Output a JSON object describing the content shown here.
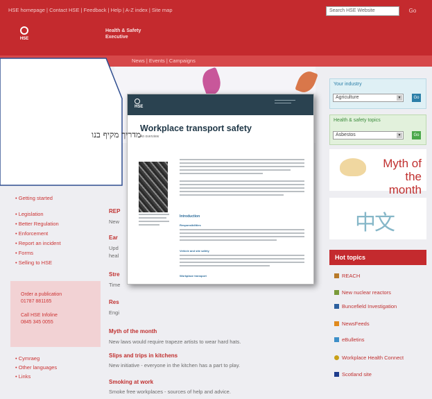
{
  "top_bar": {
    "links": [
      "HSE homepage",
      "Contact HSE",
      "Feedback",
      "Help",
      "A-Z index",
      "Site map"
    ],
    "links_text": "HSE homepage | Contact HSE | Feedback | Help | A-Z index | Site map",
    "search_placeholder": "Search HSE Website",
    "go_label": "Go"
  },
  "header": {
    "logo_text": "HSE",
    "agency_name": "Health & Safety Executive"
  },
  "nav": {
    "visible_text": "News  |  Events  |  Campaigns"
  },
  "left_nav": {
    "items_a": [
      "Getting started"
    ],
    "items_b": [
      "Legislation",
      "Better Regulation",
      "Enforcement",
      "Report an incident",
      "Forms",
      "Selling to HSE"
    ],
    "order_publication": "Order a publication",
    "order_phone": "01787 881165",
    "infoline": "Call HSE Infoline",
    "infoline_phone": "0845 345 0055",
    "items_c": [
      "Cymraeg",
      "Other languages",
      "Links"
    ]
  },
  "news": {
    "partial_heads": [
      "REP",
      "Ear",
      "Stre",
      "Res"
    ],
    "partial_bodies": [
      "New",
      "Upd",
      "heal",
      "Time",
      "Engi"
    ],
    "items": [
      {
        "title": "Myth of the month",
        "body": "New laws would require trapeze artists to wear hard hats."
      },
      {
        "title": "Slips and trips in kitchens",
        "body": "New initiative - everyone in the kitchen has a part to play."
      },
      {
        "title": "Smoking at work",
        "body": "Smoke free workplaces - sources of help and advice."
      }
    ]
  },
  "right_col": {
    "industry_label": "Your industry",
    "industry_value": "Agriculture",
    "topics_label": "Health & safety topics",
    "topics_value": "Asbestos",
    "go_label": "Go",
    "myth_text": "Myth of the month",
    "chinese_text": "中文",
    "hot_topics_title": "Hot topics",
    "hot_topics": [
      {
        "label": "REACH",
        "icon": "reach-icon",
        "color": "#b87a2a"
      },
      {
        "label": "New nuclear reactors",
        "icon": "reactor-icon",
        "color": "#7a9a3a"
      },
      {
        "label": "Buncefield Investigation",
        "icon": "investigation-icon",
        "color": "#2c5f9e"
      },
      {
        "label": "NewsFeeds",
        "icon": "rss-icon",
        "color": "#e08a1e"
      },
      {
        "label": "eBulletins",
        "icon": "bulletin-icon",
        "color": "#3d8fc8"
      },
      {
        "label": "Workplace Health Connect",
        "icon": "connect-icon",
        "color": "#c8a018"
      },
      {
        "label": "Scotland site",
        "icon": "scotland-icon",
        "color": "#1e3c8c"
      }
    ]
  },
  "document": {
    "logo_text": "HSE",
    "title": "Workplace transport safety",
    "subtitle": "An overview",
    "sections": [
      "Introduction",
      "Responsibilities",
      "Vehicle and site safety",
      "Workplace transport"
    ]
  },
  "callout": {
    "text": "מדריך מקיף בנו"
  },
  "colors": {
    "brand_red": "#c42a2e",
    "link_blue": "#2c7fa8",
    "callout_border": "#2e4d8f"
  }
}
